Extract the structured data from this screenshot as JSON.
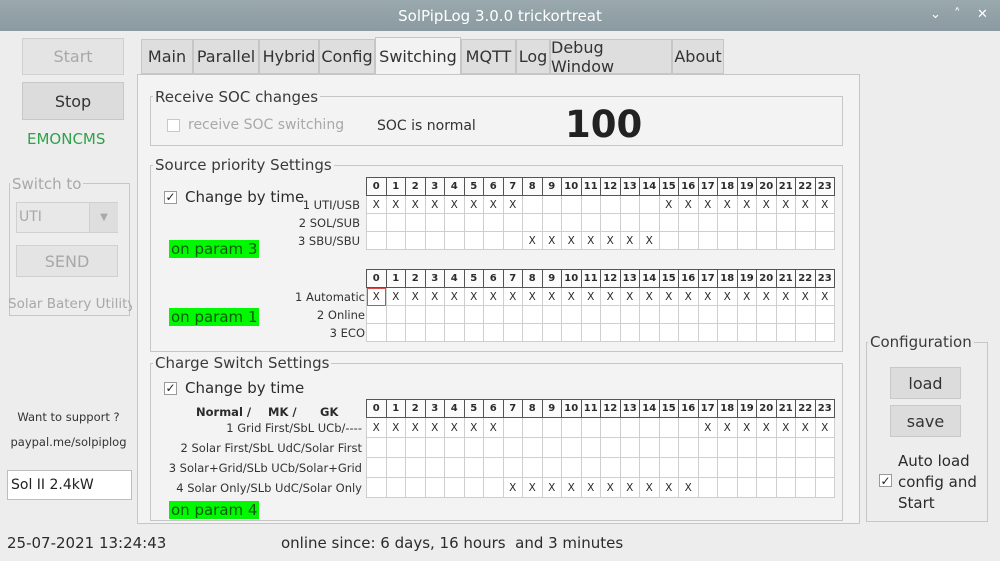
{
  "window": {
    "title": "SolPipLog 3.0.0 trickortreat"
  },
  "sidebar": {
    "start_label": "Start",
    "stop_label": "Stop",
    "emoncms_label": "EMONCMS",
    "emoncms_color": "#2fa24b",
    "switch_to": {
      "title": "Switch to",
      "select_value": "UTI",
      "send_label": "SEND",
      "hint": "Solar Batery Utility"
    },
    "support_text": "Want to support ?",
    "paypal_text": "paypal.me/solpiplog",
    "inverter_value": "Sol II 2.4kW",
    "datetime": "25-07-2021 13:24:43"
  },
  "tabs": [
    {
      "label": "Main",
      "active": false
    },
    {
      "label": "Parallel",
      "active": false
    },
    {
      "label": "Hybrid",
      "active": false
    },
    {
      "label": "Config",
      "active": false
    },
    {
      "label": "Switching",
      "active": true
    },
    {
      "label": "MQTT",
      "active": false
    },
    {
      "label": "Log",
      "active": false
    },
    {
      "label": "Debug Window",
      "active": false
    },
    {
      "label": "About",
      "active": false
    }
  ],
  "soc": {
    "title": "Receive SOC changes",
    "checkbox_label": "receive SOC switching",
    "checked": false,
    "status": "SOC is normal",
    "value": "100"
  },
  "source_priority": {
    "title": "Source priority Settings",
    "change_by_time": "Change by time",
    "checked": true,
    "param_a": "on param 3",
    "param_b": "on param 1",
    "grid_a": {
      "rows": [
        {
          "label": "1 UTI/USB",
          "hours": [
            0,
            1,
            2,
            3,
            4,
            5,
            6,
            7,
            15,
            16,
            17,
            18,
            19,
            20,
            21,
            22,
            23
          ]
        },
        {
          "label": "2 SOL/SUB",
          "hours": []
        },
        {
          "label": "3 SBU/SBU",
          "hours": [
            8,
            9,
            10,
            11,
            12,
            13,
            14
          ]
        }
      ]
    },
    "grid_b": {
      "rows": [
        {
          "label": "1 Automatic",
          "hours": [
            0,
            1,
            2,
            3,
            4,
            5,
            6,
            7,
            8,
            9,
            10,
            11,
            12,
            13,
            14,
            15,
            16,
            17,
            18,
            19,
            20,
            21,
            22,
            23
          ],
          "selected_hour": 0
        },
        {
          "label": "2 Online",
          "hours": []
        },
        {
          "label": "3 ECO",
          "hours": []
        }
      ]
    }
  },
  "charge_switch": {
    "title": "Charge Switch Settings",
    "change_by_time": "Change by time",
    "checked": true,
    "header_normal": "Normal /",
    "header_mk": "MK /",
    "header_gk": "GK",
    "param": "on param 4",
    "grid": {
      "rows": [
        {
          "label": "1 Grid First/SbL UCb/----",
          "hours": [
            0,
            1,
            2,
            3,
            4,
            5,
            6,
            17,
            18,
            19,
            20,
            21,
            22,
            23
          ]
        },
        {
          "label": "2 Solar First/SbL UdC/Solar First",
          "hours": []
        },
        {
          "label": "3 Solar+Grid/SLb UCb/Solar+Grid",
          "hours": []
        },
        {
          "label": "4 Solar Only/SLb UdC/Solar Only",
          "hours": [
            7,
            8,
            9,
            10,
            11,
            12,
            13,
            14,
            15,
            16
          ]
        }
      ]
    }
  },
  "hours": [
    "0",
    "1",
    "2",
    "3",
    "4",
    "5",
    "6",
    "7",
    "8",
    "9",
    "10",
    "11",
    "12",
    "13",
    "14",
    "15",
    "16",
    "17",
    "18",
    "19",
    "20",
    "21",
    "22",
    "23"
  ],
  "mark": "X",
  "configuration": {
    "title": "Configuration",
    "load_label": "load",
    "save_label": "save",
    "auto_load_label": "Auto load config and Start",
    "auto_load_checked": true
  },
  "statusbar": {
    "online_text": "online since: 6 days, 16 hours  and 3 minutes"
  },
  "colors": {
    "param_highlight": "#00f900",
    "title_bar": "#8f9fa5",
    "selected_cell_outline": "#d94b4b"
  }
}
